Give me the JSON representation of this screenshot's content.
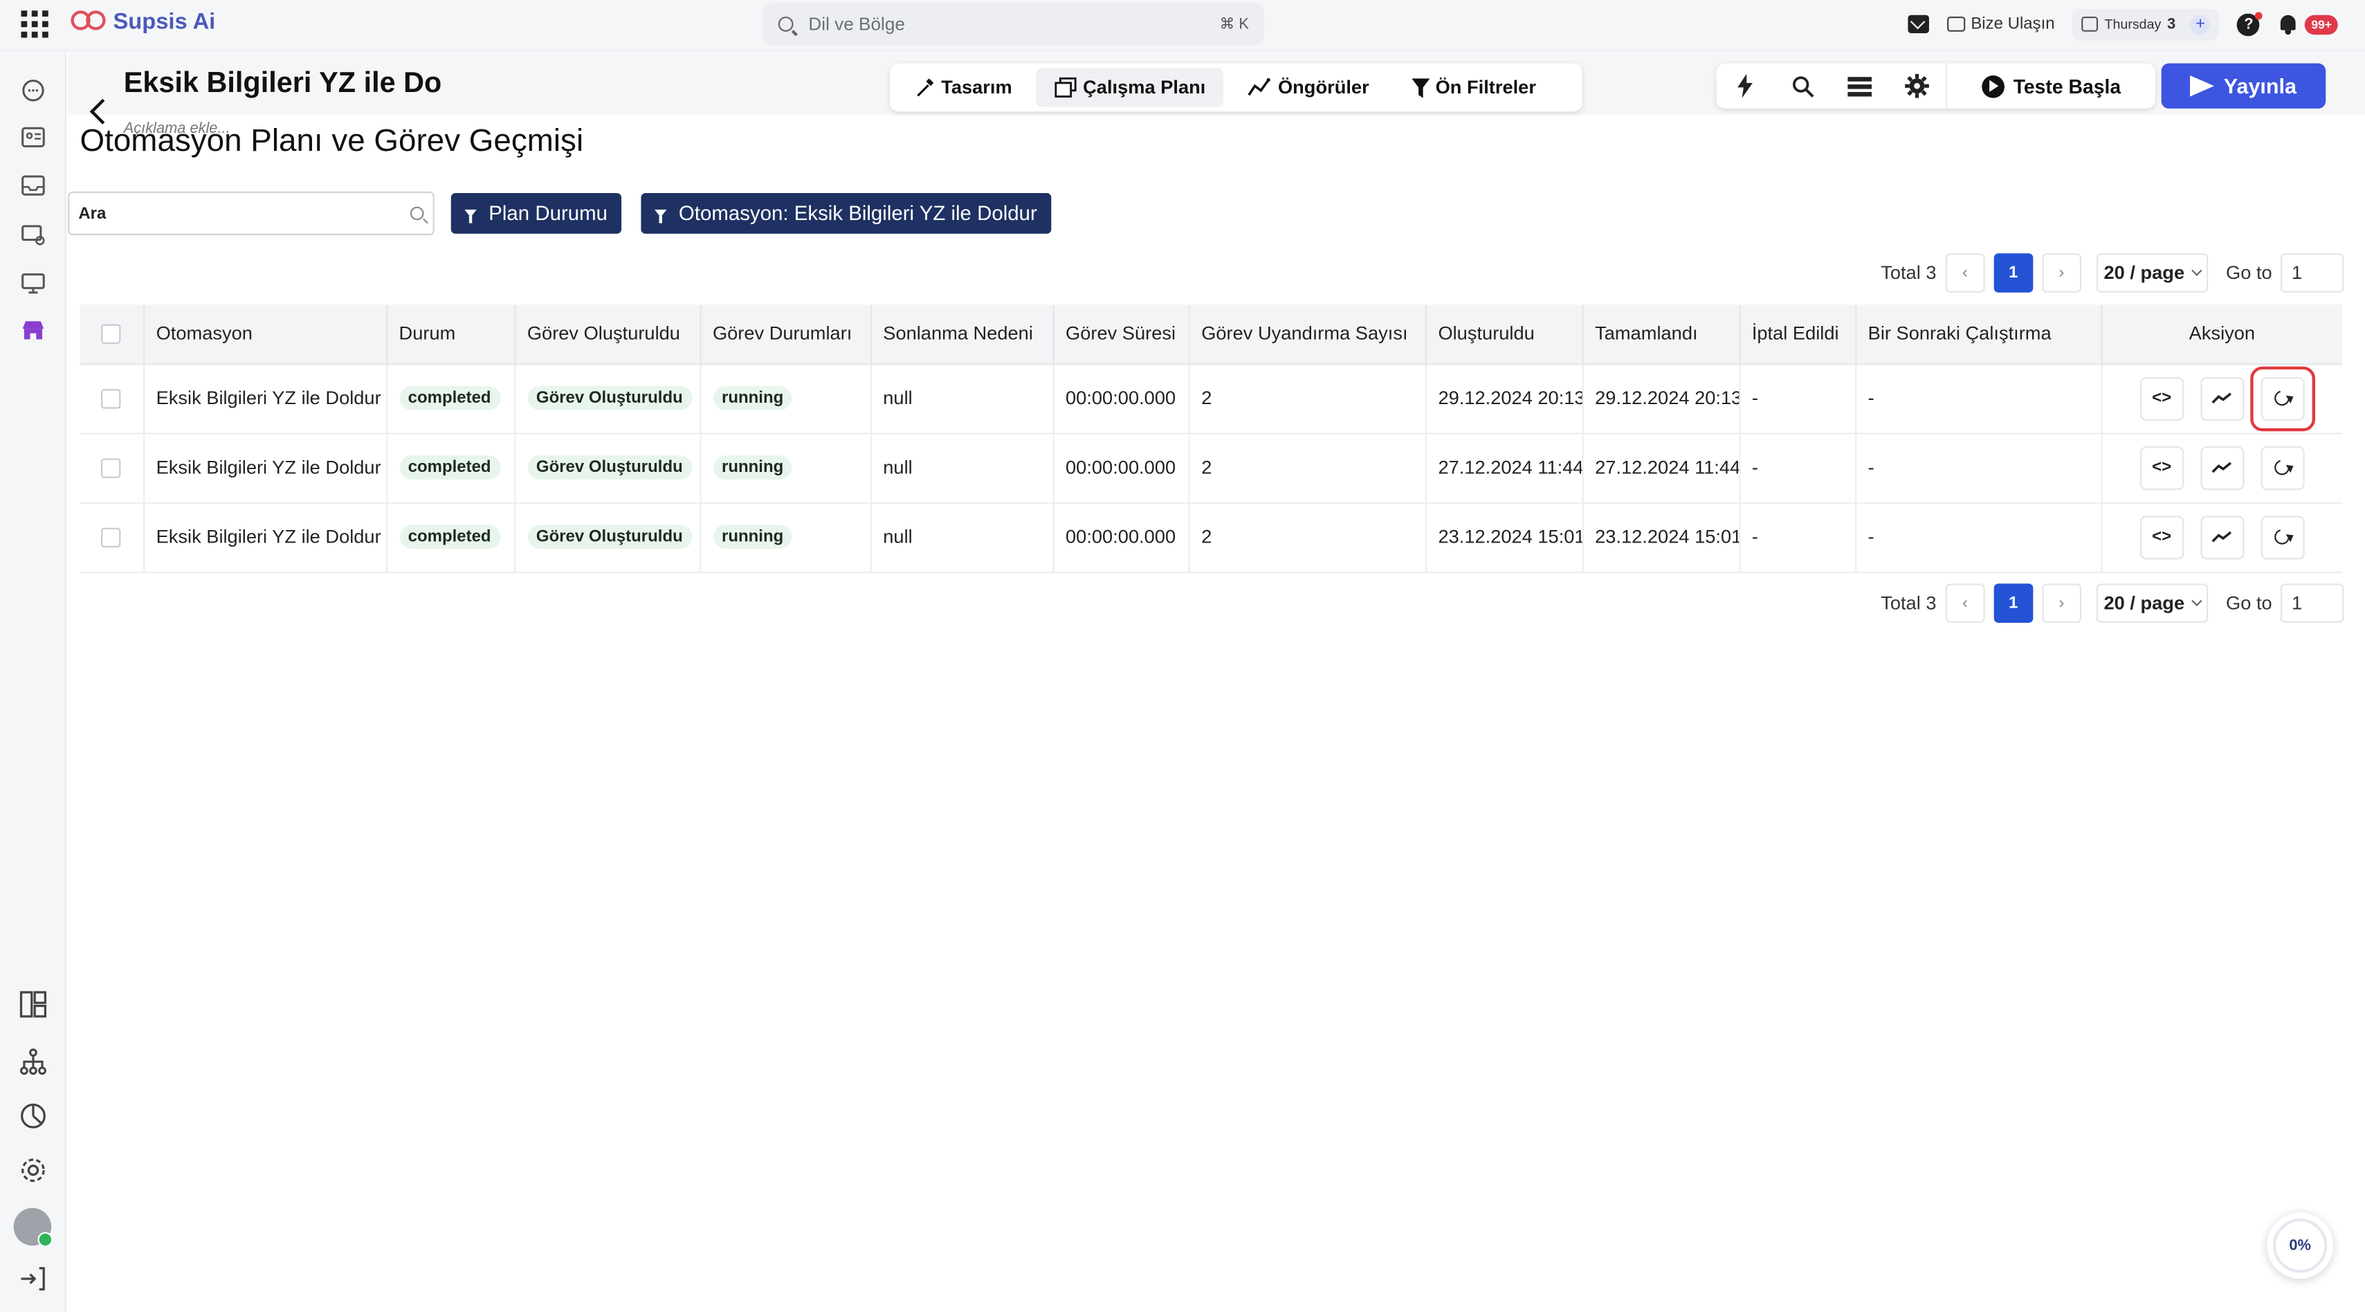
{
  "app": {
    "brand": "Supsis Ai"
  },
  "topbar": {
    "search_placeholder": "Dil ve Bölge",
    "search_shortcut": "⌘ K",
    "contact_label": "Bize Ulaşın",
    "date_day": "Thursday",
    "date_num": "3",
    "notifications_badge": "99+"
  },
  "flow": {
    "title": "Eksik Bilgileri YZ ile Doldur",
    "description_placeholder": "Açıklama ekle..."
  },
  "tabs": [
    {
      "label": "Tasarım",
      "icon": "design-icon",
      "active": false
    },
    {
      "label": "Çalışma Planı",
      "icon": "schedule-icon",
      "active": true
    },
    {
      "label": "Öngörüler",
      "icon": "insights-icon",
      "active": false
    },
    {
      "label": "Ön Filtreler",
      "icon": "filter-icon",
      "active": false
    }
  ],
  "tools": {
    "test_label": "Teste Başla",
    "publish_label": "Yayınla"
  },
  "page": {
    "title": "Otomasyon Planı ve Görev Geçmişi",
    "search_placeholder": "Ara",
    "filters": [
      "Plan Durumu",
      "Otomasyon: Eksik Bilgileri YZ ile Doldur"
    ]
  },
  "pagination": {
    "total_label": "Total 3",
    "current_page": "1",
    "page_size": "20 / page",
    "goto_label": "Go to",
    "goto_value": "1"
  },
  "table": {
    "columns": [
      "Otomasyon",
      "Durum",
      "Görev Oluşturuldu",
      "Görev Durumları",
      "Sonlanma Nedeni",
      "Görev Süresi",
      "Görev Uyandırma Sayısı",
      "Oluşturuldu",
      "Tamamlandı",
      "İptal Edildi",
      "Bir Sonraki Çalıştırma",
      "Aksiyon"
    ],
    "rows": [
      {
        "otomasyon": "Eksik Bilgileri YZ ile Doldur",
        "durum": "completed",
        "gorev_olusturuldu": "Görev Oluşturuldu",
        "gorev_durumu": "running",
        "sonlanma": "null",
        "sure": "00:00:00.000",
        "uyandirma": "2",
        "olusturuldu": "29.12.2024 20:13",
        "tamamlandi": "29.12.2024 20:13",
        "iptal": "-",
        "sonraki": "-",
        "highlight_refresh": true
      },
      {
        "otomasyon": "Eksik Bilgileri YZ ile Doldur",
        "durum": "completed",
        "gorev_olusturuldu": "Görev Oluşturuldu",
        "gorev_durumu": "running",
        "sonlanma": "null",
        "sure": "00:00:00.000",
        "uyandirma": "2",
        "olusturuldu": "27.12.2024 11:44",
        "tamamlandi": "27.12.2024 11:44",
        "iptal": "-",
        "sonraki": "-",
        "highlight_refresh": false
      },
      {
        "otomasyon": "Eksik Bilgileri YZ ile Doldur",
        "durum": "completed",
        "gorev_olusturuldu": "Görev Oluşturuldu",
        "gorev_durumu": "running",
        "sonlanma": "null",
        "sure": "00:00:00.000",
        "uyandirma": "2",
        "olusturuldu": "23.12.2024 15:01",
        "tamamlandi": "23.12.2024 15:01",
        "iptal": "-",
        "sonraki": "-",
        "highlight_refresh": false
      }
    ],
    "action_code_label": "<>"
  },
  "progress": {
    "value": "0%"
  },
  "colors": {
    "primary": "#3d55e0",
    "filter_chip": "#1f3162",
    "tag_bg": "#e8f5ec",
    "highlight": "#e0393e"
  }
}
